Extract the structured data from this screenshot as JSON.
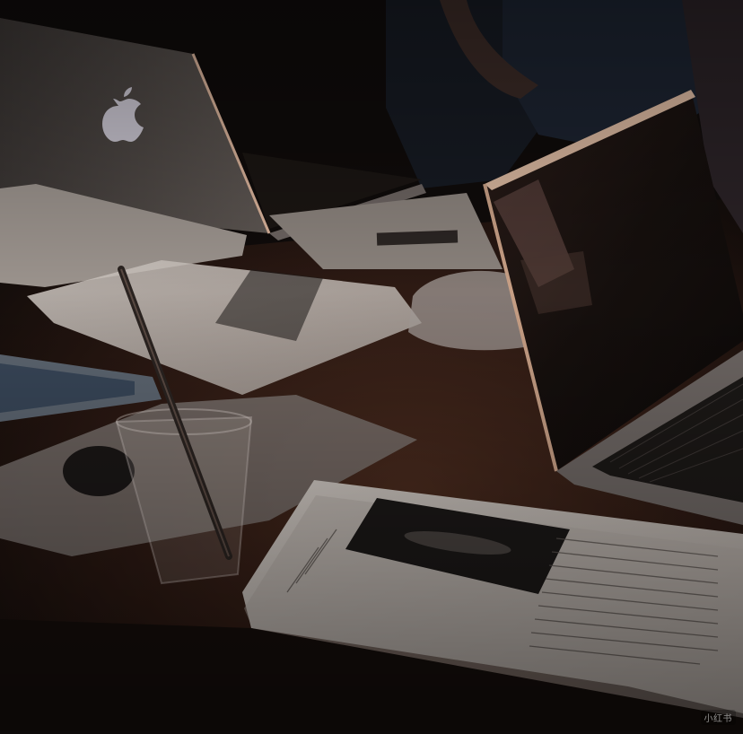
{
  "scene": {
    "watermark_text": "小红书",
    "palette": {
      "background": "#0e0b0a",
      "table": "#3a2218",
      "paper": "#bdb6b0",
      "paper_shadow": "#8f8883",
      "laptop_silver": "#7a736f",
      "laptop_edge": "#c9a48a",
      "screen": "#140e0c",
      "shirt": "#1c2330"
    }
  }
}
